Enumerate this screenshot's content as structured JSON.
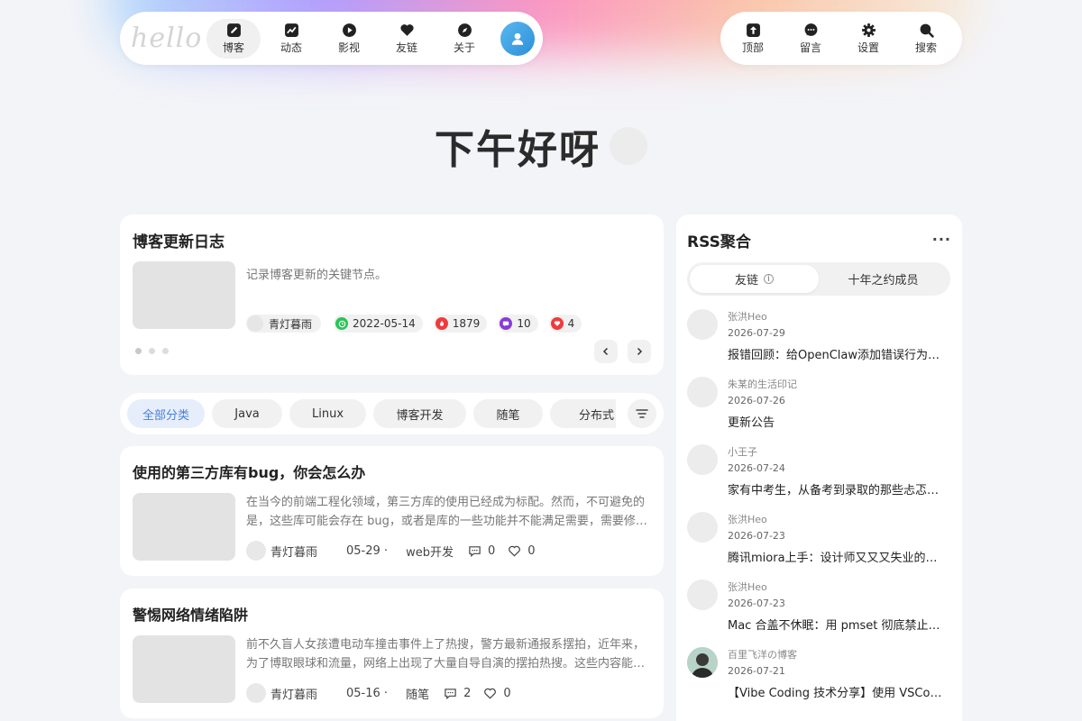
{
  "nav": {
    "logo": "hello",
    "items": [
      {
        "label": "博客",
        "icon": "pen-icon"
      },
      {
        "label": "动态",
        "icon": "activity-icon"
      },
      {
        "label": "影视",
        "icon": "play-icon"
      },
      {
        "label": "友链",
        "icon": "heart-icon"
      },
      {
        "label": "关于",
        "icon": "compass-icon"
      }
    ],
    "right_items": [
      {
        "label": "顶部",
        "icon": "arrow-up-icon"
      },
      {
        "label": "留言",
        "icon": "message-icon"
      },
      {
        "label": "设置",
        "icon": "gear-icon"
      },
      {
        "label": "搜索",
        "icon": "search-icon"
      }
    ]
  },
  "greeting": "下午好呀",
  "update_log": {
    "title": "博客更新日志",
    "desc": "记录博客更新的关键节点。",
    "author": "青灯暮雨",
    "date": "2022-05-14",
    "views": "1879",
    "comments": "10",
    "likes": "4",
    "colors": {
      "date": "#2cc35a",
      "views": "#ef3b3b",
      "comments": "#8a3bd6",
      "likes": "#ef3b3b"
    }
  },
  "categories": [
    "全部分类",
    "Java",
    "Linux",
    "博客开发",
    "随笔",
    "分布式"
  ],
  "posts": [
    {
      "title": "使用的第三方库有bug，你会怎么办",
      "excerpt": "在当今的前端工程化领域，第三方库的使用已经成为标配。然而，不可避免的是，这些库可能会存在 bug，或者是库的一些功能并不能满足需要，需要修改源码。",
      "author": "青灯暮雨",
      "date": "05-29 ·",
      "tag": "web开发",
      "comments": "0",
      "likes": "0"
    },
    {
      "title": "警惕网络情绪陷阱",
      "excerpt": "前不久盲人女孩遭电动车撞击事件上了热搜，警方最新通报系摆拍，近年来，为了博取眼球和流量，网络上出现了大量自导自演的摆拍热搜。这些内容能够迅速引发关注。",
      "author": "青灯暮雨",
      "date": "05-16 ·",
      "tag": "随笔",
      "comments": "2",
      "likes": "0"
    }
  ],
  "rss": {
    "title": "RSS聚合",
    "more": "···",
    "tabs": [
      "友链",
      "十年之约成员"
    ],
    "info_glyph": "i",
    "items": [
      {
        "source": "张洪Heo",
        "date": "2026-07-29",
        "title": "报错回顾：给OpenClaw添加错误行为拦截"
      },
      {
        "source": "朱某的生活印记",
        "date": "2026-07-26",
        "title": "更新公告"
      },
      {
        "source": "小王子",
        "date": "2026-07-24",
        "title": "家有中考生，从备考到录取的那些忐忑与成长"
      },
      {
        "source": "张洪Heo",
        "date": "2026-07-23",
        "title": "腾讯miora上手：设计师又又又失业的一天"
      },
      {
        "source": "张洪Heo",
        "date": "2026-07-23",
        "title": "Mac 合盖不休眠：用 pmset 彻底禁止睡眠"
      },
      {
        "source": "百里飞洋の博客",
        "date": "2026-07-21",
        "title": "【Vibe Coding 技术分享】使用 VSCode 与 AI"
      }
    ]
  }
}
